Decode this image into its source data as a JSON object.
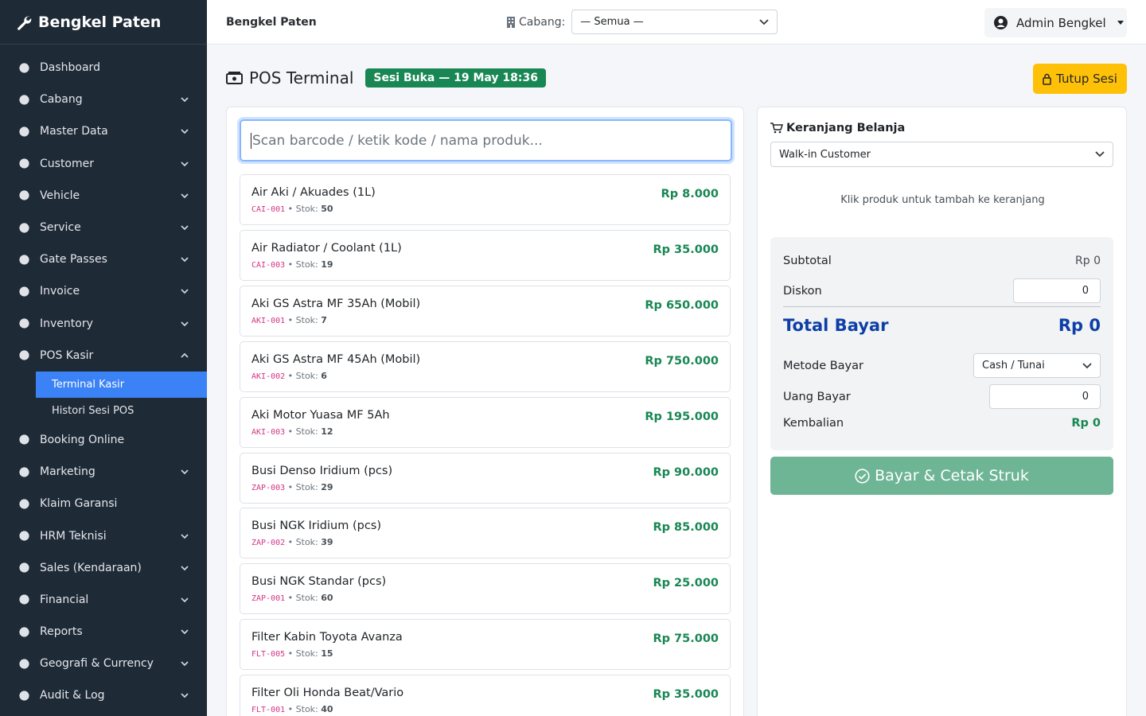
{
  "sidebar": {
    "brand": "Bengkel Paten",
    "items": [
      {
        "label": "Dashboard",
        "icon": "dashboard-icon",
        "chevron": ""
      },
      {
        "label": "Cabang",
        "icon": "building-icon",
        "chevron": "down"
      },
      {
        "label": "Master Data",
        "icon": "database-icon",
        "chevron": "down"
      },
      {
        "label": "Customer",
        "icon": "users-icon",
        "chevron": "down"
      },
      {
        "label": "Vehicle",
        "icon": "car-icon",
        "chevron": "down"
      },
      {
        "label": "Service",
        "icon": "tools-icon",
        "chevron": "down"
      },
      {
        "label": "Gate Passes",
        "icon": "ticket-icon",
        "chevron": "down"
      },
      {
        "label": "Invoice",
        "icon": "file-invoice-icon",
        "chevron": "down"
      },
      {
        "label": "Inventory",
        "icon": "boxes-icon",
        "chevron": "down"
      },
      {
        "label": "POS Kasir",
        "icon": "cash-register-icon",
        "chevron": "up"
      }
    ],
    "pos_sub": [
      {
        "label": "Terminal Kasir",
        "active": true
      },
      {
        "label": "Histori Sesi POS",
        "active": false
      }
    ],
    "items_after": [
      {
        "label": "Booking Online",
        "icon": "calendar-icon",
        "chevron": ""
      },
      {
        "label": "Marketing",
        "icon": "gift-icon",
        "chevron": "down"
      },
      {
        "label": "Klaim Garansi",
        "icon": "shield-icon",
        "chevron": ""
      },
      {
        "label": "HRM Teknisi",
        "icon": "user-tie-icon",
        "chevron": "down"
      },
      {
        "label": "Sales (Kendaraan)",
        "icon": "cart-icon",
        "chevron": "down"
      },
      {
        "label": "Financial",
        "icon": "chart-line-icon",
        "chevron": "down"
      },
      {
        "label": "Reports",
        "icon": "report-icon",
        "chevron": "down"
      },
      {
        "label": "Geografi & Currency",
        "icon": "globe-icon",
        "chevron": "down"
      },
      {
        "label": "Audit & Log",
        "icon": "history-icon",
        "chevron": "down"
      }
    ]
  },
  "topbar": {
    "title": "Bengkel Paten",
    "cabang_label": "Cabang:",
    "cabang_value": "— Semua —",
    "user_name": "Admin Bengkel"
  },
  "page": {
    "title": "POS Terminal",
    "session_badge": "Sesi Buka — 19 May 18:36",
    "close_session_label": "Tutup Sesi"
  },
  "search": {
    "placeholder": "Scan barcode / ketik kode / nama produk..."
  },
  "products": [
    {
      "name": "Air Aki / Akuades (1L)",
      "code": "CAI-001",
      "stock": "50",
      "price": "Rp 8.000"
    },
    {
      "name": "Air Radiator / Coolant (1L)",
      "code": "CAI-003",
      "stock": "19",
      "price": "Rp 35.000"
    },
    {
      "name": "Aki GS Astra MF 35Ah (Mobil)",
      "code": "AKI-001",
      "stock": "7",
      "price": "Rp 650.000"
    },
    {
      "name": "Aki GS Astra MF 45Ah (Mobil)",
      "code": "AKI-002",
      "stock": "6",
      "price": "Rp 750.000"
    },
    {
      "name": "Aki Motor Yuasa MF 5Ah",
      "code": "AKI-003",
      "stock": "12",
      "price": "Rp 195.000"
    },
    {
      "name": "Busi Denso Iridium (pcs)",
      "code": "ZAP-003",
      "stock": "29",
      "price": "Rp 90.000"
    },
    {
      "name": "Busi NGK Iridium (pcs)",
      "code": "ZAP-002",
      "stock": "39",
      "price": "Rp 85.000"
    },
    {
      "name": "Busi NGK Standar (pcs)",
      "code": "ZAP-001",
      "stock": "60",
      "price": "Rp 25.000"
    },
    {
      "name": "Filter Kabin Toyota Avanza",
      "code": "FLT-005",
      "stock": "15",
      "price": "Rp 75.000"
    },
    {
      "name": "Filter Oli Honda Beat/Vario",
      "code": "FLT-001",
      "stock": "40",
      "price": "Rp 35.000"
    }
  ],
  "stock_label": "Stok:",
  "stock_sep": "•",
  "cart": {
    "title": "Keranjang Belanja",
    "customer": "Walk-in Customer",
    "empty_text": "Klik produk untuk tambah ke keranjang",
    "subtotal_label": "Subtotal",
    "subtotal_value": "Rp 0",
    "discount_label": "Diskon",
    "discount_value": "0",
    "total_label": "Total Bayar",
    "total_value": "Rp 0",
    "method_label": "Metode Bayar",
    "method_value": "Cash / Tunai",
    "paid_label": "Uang Bayar",
    "paid_value": "0",
    "change_label": "Kembalian",
    "change_value": "Rp 0",
    "pay_button": "Bayar & Cetak Struk"
  },
  "colors": {
    "sidebar_bg": "#1f2a37",
    "active": "#3b82f6",
    "price": "#198754",
    "warning": "#ffc107",
    "total": "#0d3fa6",
    "pay": "#6db595"
  }
}
